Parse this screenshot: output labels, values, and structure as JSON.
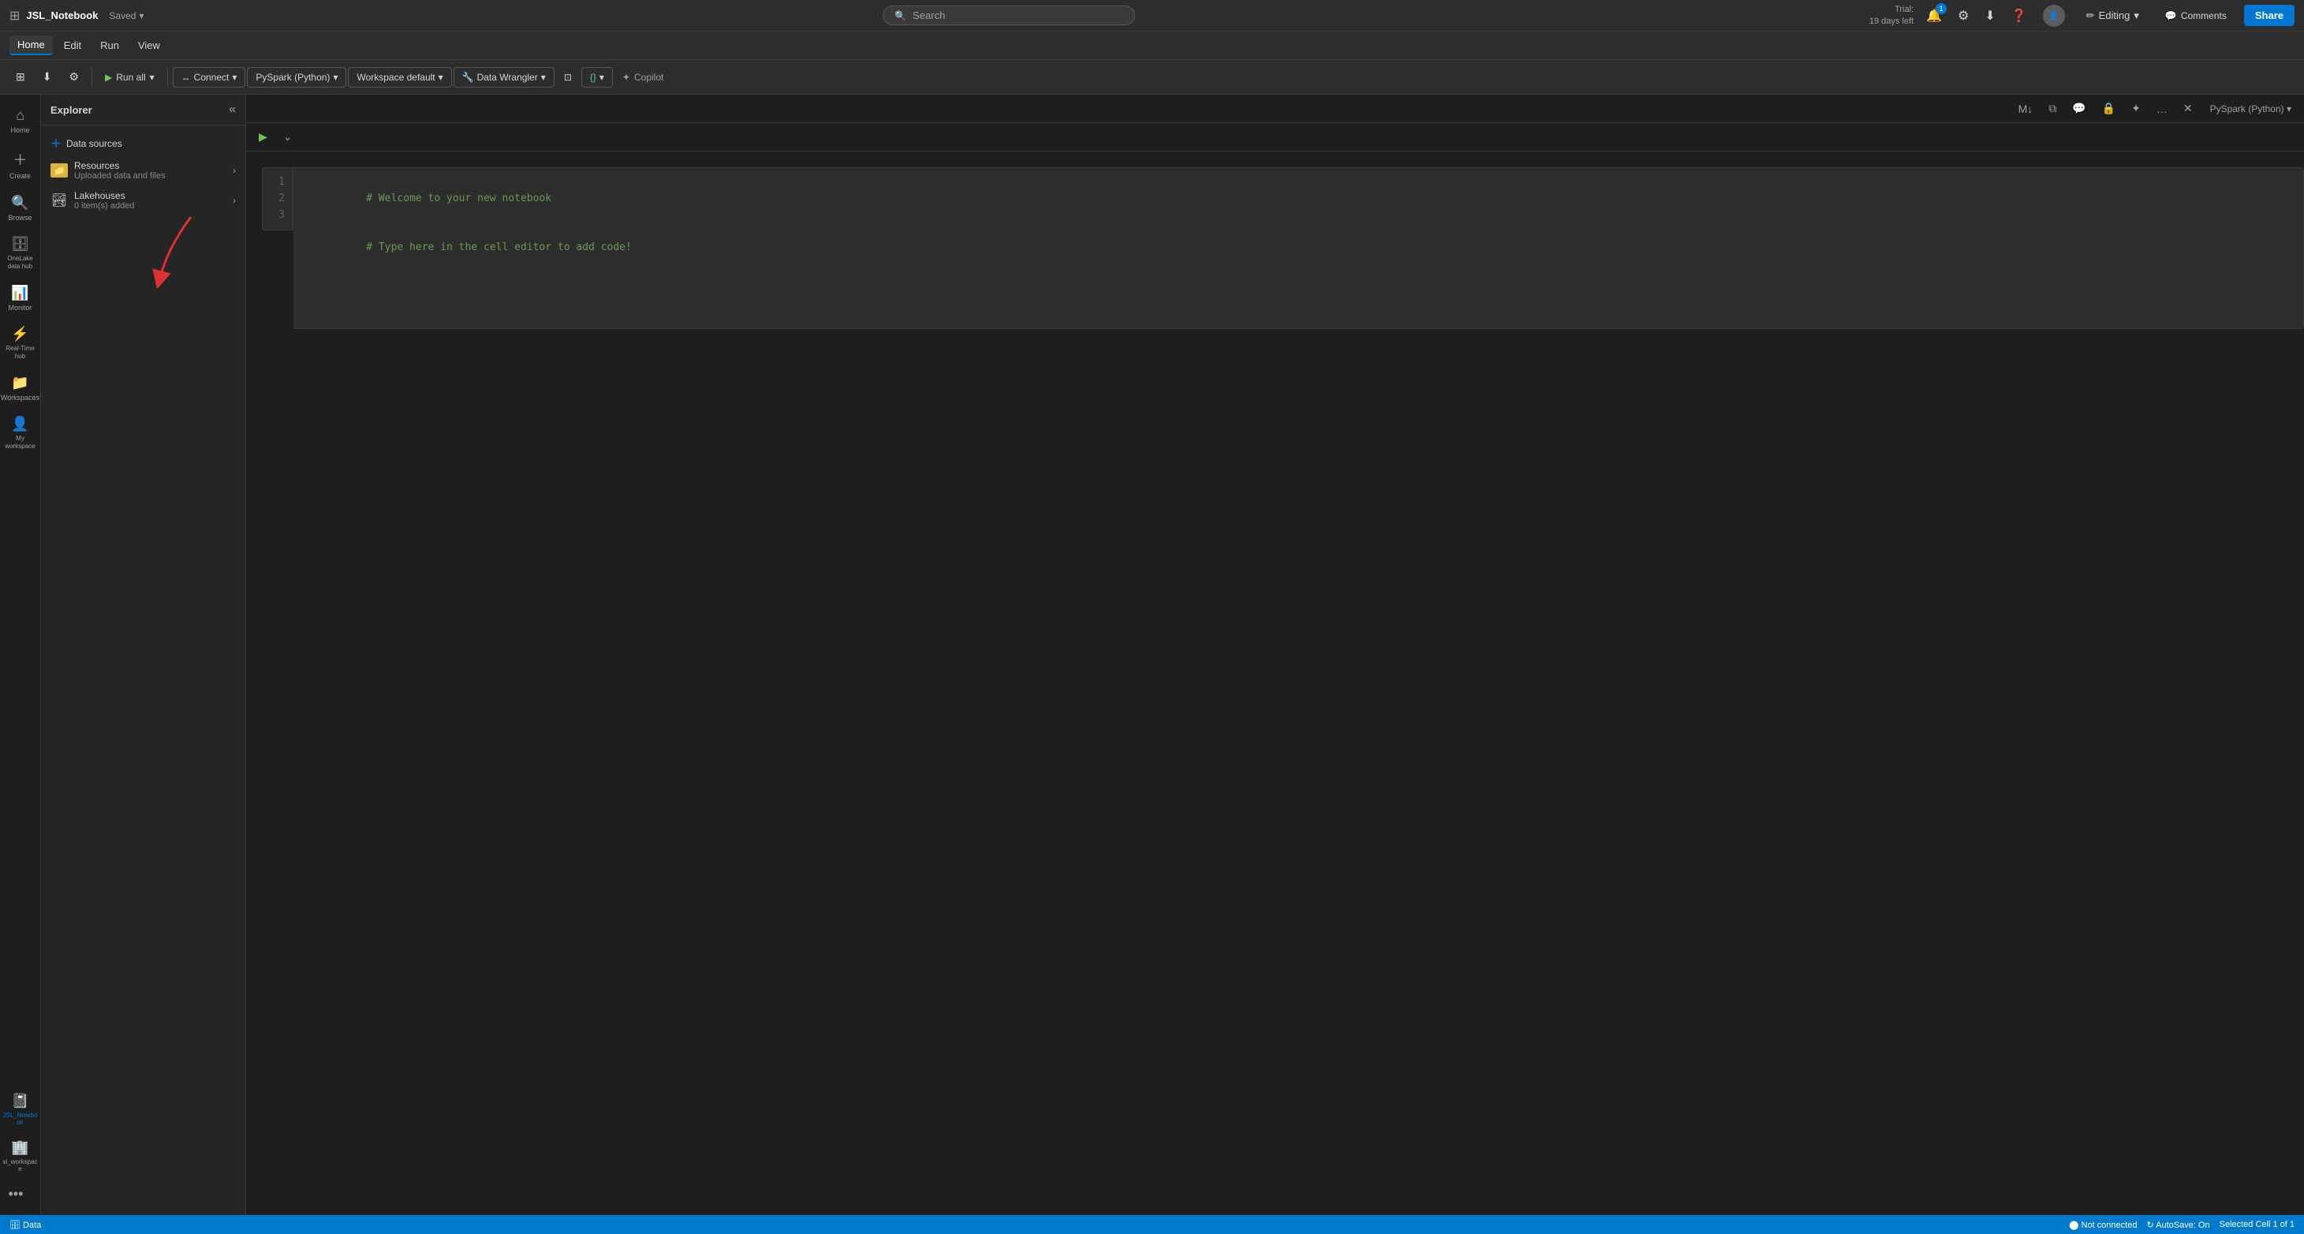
{
  "titleBar": {
    "appGridIcon": "⊞",
    "appName": "JSL_Notebook",
    "savedLabel": "Saved",
    "savedChevron": "▾",
    "searchPlaceholder": "Search",
    "trial": {
      "label": "Trial:",
      "daysLeft": "19 days left"
    },
    "notificationCount": "1",
    "editingLabel": "Editing",
    "editingChevron": "▾",
    "commentsLabel": "Comments",
    "shareLabel": "Share"
  },
  "menuBar": {
    "items": [
      "Home",
      "Edit",
      "Run",
      "View"
    ]
  },
  "toolbar": {
    "addCellIcon": "⊞",
    "downloadIcon": "⬇",
    "settingsIcon": "⚙",
    "runAllLabel": "Run all",
    "runAllChevron": "▾",
    "connectLabel": "Connect",
    "connectChevron": "▾",
    "pysparkLabel": "PySpark (Python)",
    "pysparkChevron": "▾",
    "workspaceLabel": "Workspace default",
    "workspaceChevron": "▾",
    "dataWranglerLabel": "Data Wrangler",
    "dataWranglerChevron": "▾",
    "layoutIcon": "⊡",
    "vscodeIcon": "{}",
    "vscodeChevron": "▾",
    "copilotIcon": "✦",
    "copilotLabel": "Copilot"
  },
  "explorer": {
    "title": "Explorer",
    "collapseIcon": "«",
    "addDataSourcesLabel": "Data sources",
    "sections": [
      {
        "id": "resources",
        "title": "Resources",
        "subtitle": "Uploaded data and files",
        "iconType": "folder",
        "iconColor": "#dcb444",
        "chevron": "›"
      },
      {
        "id": "lakehouses",
        "title": "Lakehouses",
        "subtitle": "0 item(s) added",
        "iconType": "lakehouse",
        "chevron": "›"
      }
    ]
  },
  "notebook": {
    "cellControls": {
      "playIcon": "▶",
      "chevronDown": "⌄"
    },
    "topControls": {
      "mlIcon": "M↓",
      "duplicateIcon": "⧉",
      "commentIcon": "💬",
      "lockIcon": "🔒",
      "splitIcon": "✦",
      "moreIcon": "…",
      "closeIcon": "✕",
      "langLabel": "PySpark (Python)",
      "langChevron": "▾"
    },
    "cell": {
      "lineNumbers": [
        "1",
        "2",
        "3"
      ],
      "lines": [
        "# Welcome to your new notebook",
        "# Type here in the cell editor to add code!",
        ""
      ]
    }
  },
  "statusBar": {
    "notConnected": "⬤ Not connected",
    "autoSave": "↻ AutoSave: On",
    "selectedCell": "Selected Cell 1 of 1"
  },
  "leftNav": {
    "items": [
      {
        "id": "home",
        "icon": "⌂",
        "label": "Home"
      },
      {
        "id": "create",
        "icon": "+",
        "label": "Create"
      },
      {
        "id": "browse",
        "icon": "🔍",
        "label": "Browse"
      },
      {
        "id": "onelake",
        "icon": "🗄",
        "label": "OneLake data hub"
      },
      {
        "id": "monitor",
        "icon": "📊",
        "label": "Monitor"
      },
      {
        "id": "realtime",
        "icon": "⚡",
        "label": "Real-Time hub"
      },
      {
        "id": "workspaces",
        "icon": "📁",
        "label": "Workspaces"
      },
      {
        "id": "myworkspace",
        "icon": "👤",
        "label": "My workspace"
      }
    ],
    "activeNotebook": {
      "icon": "📓",
      "label": "JSL_Notebo ok"
    },
    "workspaceItem": {
      "icon": "🏢",
      "label": "sl_workspac e"
    },
    "moreIcon": "•••"
  }
}
